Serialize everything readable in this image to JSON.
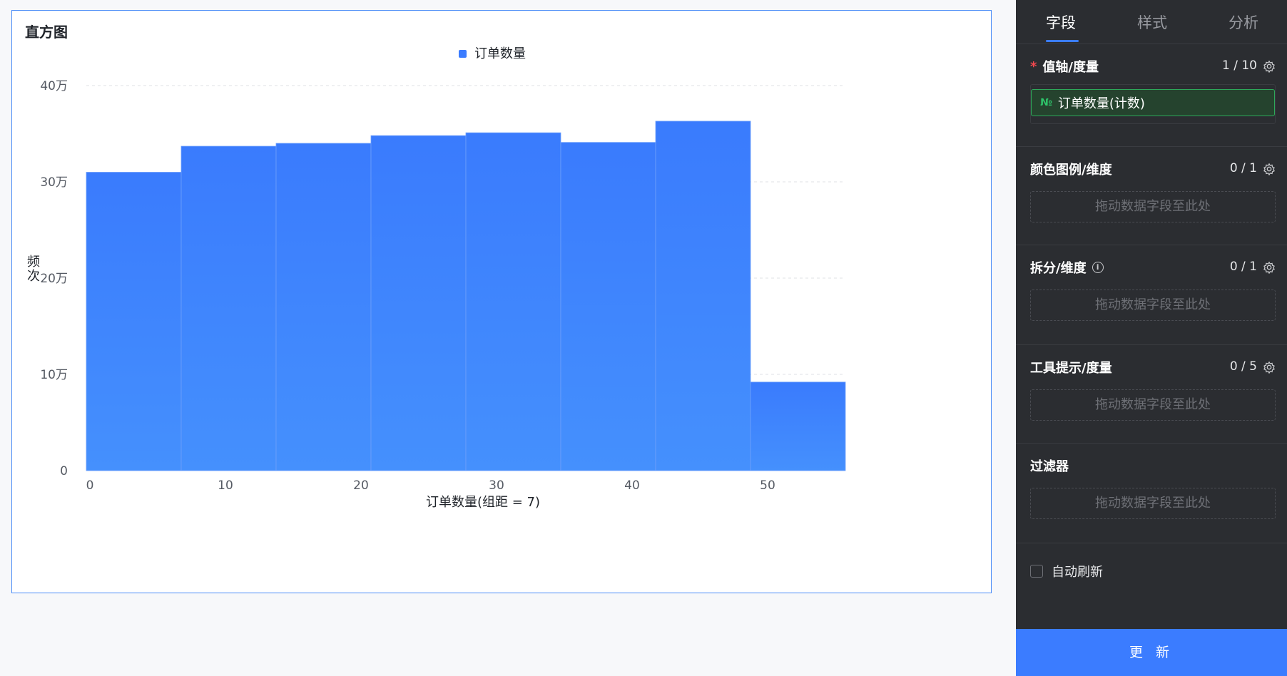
{
  "chart_card": {
    "title": "直方图"
  },
  "chart_data": {
    "type": "bar",
    "title": "",
    "legend": [
      "订单数量"
    ],
    "legend_position": "top-center",
    "xlabel": "订单数量(组距 = 7)",
    "ylabel": "频次",
    "x_tick_labels": [
      "0",
      "10",
      "20",
      "30",
      "40",
      "50"
    ],
    "y_tick_labels": [
      "0",
      "10万",
      "20万",
      "30万",
      "40万"
    ],
    "ylim": [
      0,
      400000
    ],
    "xlim": [
      0,
      56
    ],
    "bin_width": 7,
    "bins": [
      [
        0,
        7
      ],
      [
        7,
        14
      ],
      [
        14,
        21
      ],
      [
        21,
        28
      ],
      [
        28,
        35
      ],
      [
        35,
        42
      ],
      [
        42,
        49
      ],
      [
        49,
        56
      ]
    ],
    "values": [
      310000,
      337000,
      340000,
      348000,
      351000,
      341000,
      363000,
      92000
    ],
    "grid": "horizontal-dashed",
    "color": "#3b7cff"
  },
  "panel": {
    "tabs": [
      "字段",
      "样式",
      "分析"
    ],
    "active_tab": 0,
    "sections": {
      "value_axis": {
        "required_mark": "*",
        "title": "值轴/度量",
        "count": "1 / 10",
        "field": {
          "icon": "№",
          "label": "订单数量(计数)"
        }
      },
      "color_legend": {
        "title": "颜色图例/维度",
        "count": "0 / 1",
        "placeholder": "拖动数据字段至此处"
      },
      "split": {
        "title": "拆分/维度",
        "info_icon": "i",
        "count": "0 / 1",
        "placeholder": "拖动数据字段至此处"
      },
      "tooltip": {
        "title": "工具提示/度量",
        "count": "0 / 5",
        "placeholder": "拖动数据字段至此处"
      },
      "filter": {
        "title": "过滤器",
        "placeholder": "拖动数据字段至此处"
      }
    },
    "auto_refresh": {
      "label": "自动刷新",
      "checked": false
    },
    "update_button": "更 新"
  }
}
